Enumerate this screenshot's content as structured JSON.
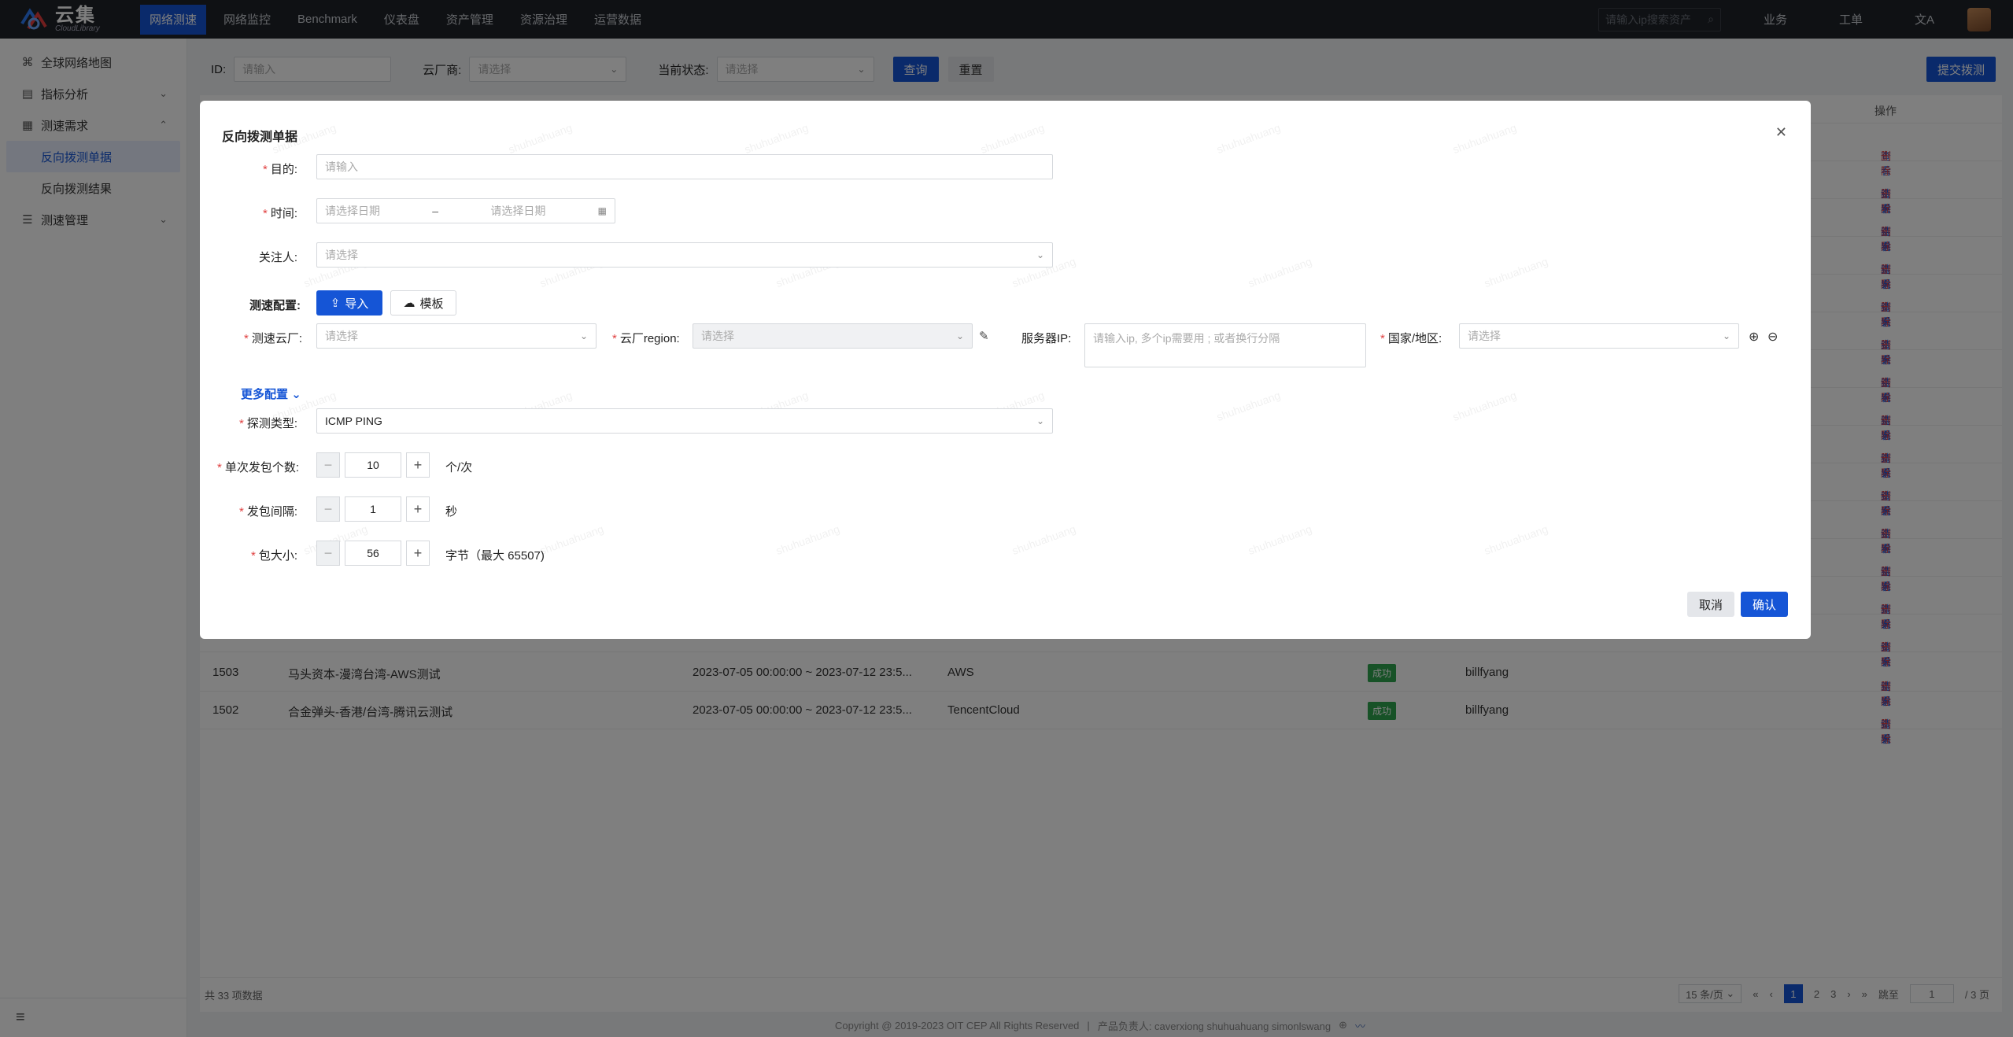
{
  "app": {
    "logo_cn": "云集",
    "logo_en": "CloudLibrary",
    "nav": [
      "网络测速",
      "网络监控",
      "Benchmark",
      "仪表盘",
      "资产管理",
      "资源治理",
      "运营数据"
    ],
    "search_placeholder": "请输入ip搜索资产",
    "right_links": [
      "业务",
      "工单"
    ],
    "lang_icon": "文A"
  },
  "sidebar": {
    "items": [
      {
        "label": "全球网络地图",
        "icon": "map-icon"
      },
      {
        "label": "指标分析",
        "icon": "chart-icon"
      },
      {
        "label": "测速需求",
        "icon": "server-icon"
      },
      {
        "label": "测速管理",
        "icon": "list-icon"
      }
    ],
    "subitems": [
      "反向拨测单据",
      "反向拨测结果"
    ],
    "collapse_icon": "≡"
  },
  "filters": {
    "id_label": "ID:",
    "id_placeholder": "请输入",
    "vendor_label": "云厂商:",
    "vendor_placeholder": "请选择",
    "status_label": "当前状态:",
    "status_placeholder": "请选择",
    "query": "查询",
    "reset": "重置",
    "submit": "提交拨测"
  },
  "table": {
    "op_header": "操作",
    "actions": {
      "view": "查看",
      "result": "结果",
      "delete": "删除"
    },
    "row_1503": {
      "id": "1503",
      "purpose": "马头资本-漫湾台湾-AWS测试",
      "time": "2023-07-05 00:00:00 ~ 2023-07-12 23:5...",
      "vendor": "AWS",
      "status": "成功",
      "owner": "billfyang"
    },
    "row_1502": {
      "id": "1502",
      "purpose": "合金弹头-香港/台湾-腾讯云测试",
      "time": "2023-07-05 00:00:00 ~ 2023-07-12 23:5...",
      "vendor": "TencentCloud",
      "status": "成功",
      "owner": "billfyang"
    },
    "total": "共 33 项数据",
    "page_size": "15 条/页",
    "pages": [
      "1",
      "2",
      "3"
    ],
    "jump_label": "跳至",
    "jump_value": "1",
    "page_total": "/ 3 页"
  },
  "footer": {
    "copyright": "Copyright @ 2019-2023  OIT CEP  All Rights Reserved",
    "owners": "产品负责人: caverxiong shuhuahuang simonlswang"
  },
  "modal": {
    "title": "反向拨测单据",
    "purpose_label": "目的:",
    "purpose_placeholder": "请输入",
    "time_label": "时间:",
    "date_start": "请选择日期",
    "date_sep": "–",
    "date_end": "请选择日期",
    "follower_label": "关注人:",
    "follower_placeholder": "请选择",
    "config_label": "测速配置:",
    "import_btn": "导入",
    "template_btn": "模板",
    "vendor_label": "测速云厂:",
    "vendor_placeholder": "请选择",
    "region_label": "云厂region:",
    "region_placeholder": "请选择",
    "server_ip_label": "服务器IP:",
    "server_ip_placeholder": "请输入ip, 多个ip需要用 ; 或者换行分隔",
    "country_label": "国家/地区:",
    "country_placeholder": "请选择",
    "more_config": "更多配置",
    "probe_type_label": "探测类型:",
    "probe_type_value": "ICMP PING",
    "packets_label": "单次发包个数:",
    "packets_value": "10",
    "packets_unit": "个/次",
    "interval_label": "发包间隔:",
    "interval_value": "1",
    "interval_unit": "秒",
    "size_label": "包大小:",
    "size_value": "56",
    "size_unit": "字节（最大 65507)",
    "cancel": "取消",
    "confirm": "确认",
    "watermark": "shuhuahuang"
  }
}
